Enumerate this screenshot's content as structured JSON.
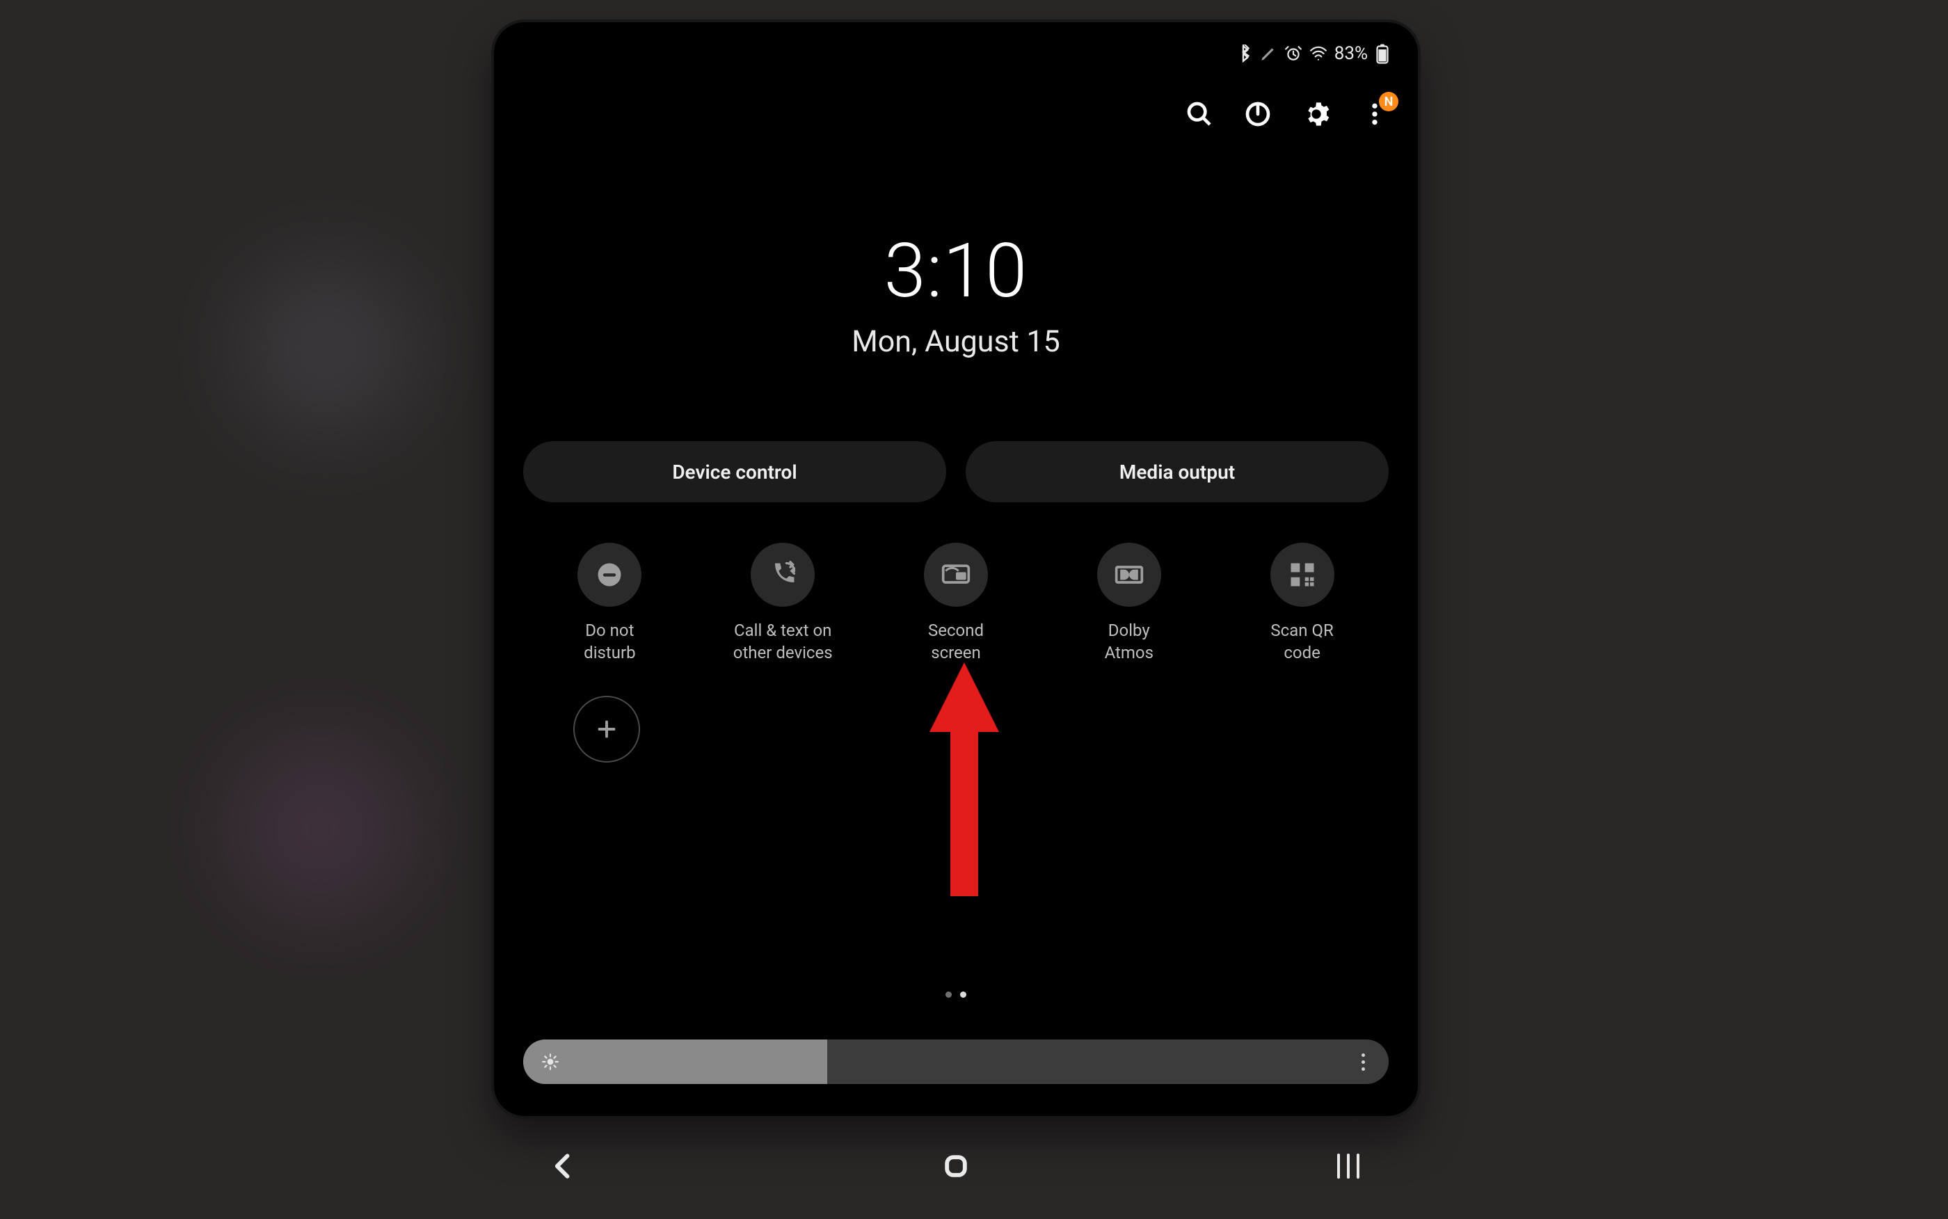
{
  "status": {
    "battery_text": "83%"
  },
  "toolbar": {
    "more_badge": "N"
  },
  "clock": {
    "time": "3:10",
    "date": "Mon, August 15"
  },
  "pills": {
    "device_control": "Device control",
    "media_output": "Media output"
  },
  "tiles": [
    {
      "label": "Do not\ndisturb"
    },
    {
      "label": "Call & text on\nother devices"
    },
    {
      "label": "Second\nscreen"
    },
    {
      "label": "Dolby\nAtmos"
    },
    {
      "label": "Scan QR\ncode"
    }
  ],
  "brightness": {
    "percent": 33
  }
}
